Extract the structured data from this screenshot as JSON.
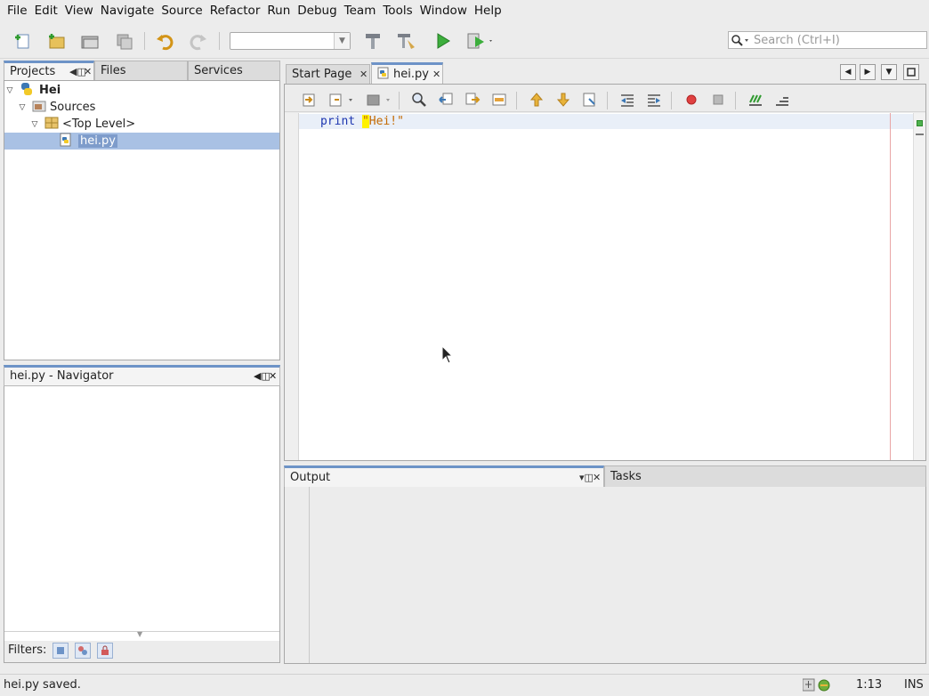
{
  "menu": [
    "File",
    "Edit",
    "View",
    "Navigate",
    "Source",
    "Refactor",
    "Run",
    "Debug",
    "Team",
    "Tools",
    "Window",
    "Help"
  ],
  "search": {
    "placeholder": "Search (Ctrl+I)"
  },
  "projects_panel": {
    "tabs": [
      "Projects",
      "Files",
      "Services"
    ],
    "tree": {
      "project": "Hei",
      "sources": "Sources",
      "package": "<Top Level>",
      "file": "hei.py"
    }
  },
  "navigator": {
    "title": "hei.py - Navigator",
    "filters_label": "Filters:"
  },
  "editor": {
    "tabs": [
      "Start Page",
      "hei.py"
    ],
    "code": {
      "keyword": "print",
      "string_quote_open": "\"",
      "string_body": "Hei!\""
    }
  },
  "output_panel": {
    "tabs": [
      "Output",
      "Tasks"
    ]
  },
  "status": {
    "message": "hei.py saved.",
    "position": "1:13",
    "mode": "INS"
  },
  "colors": {
    "selection": "#a9c1e4",
    "accent_tab": "#6d93c7",
    "keyword": "#1c35b0",
    "string": "#c46a00",
    "highlight": "#fff200"
  }
}
